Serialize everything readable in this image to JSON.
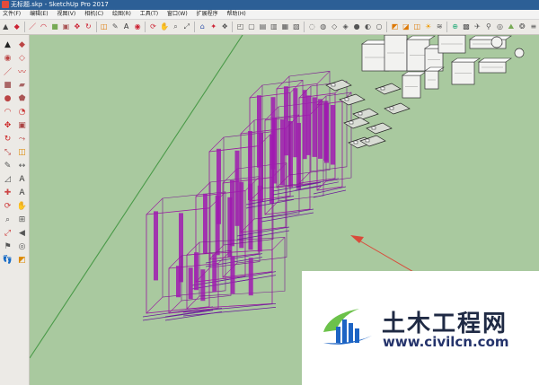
{
  "window": {
    "title": "无标题.skp - SketchUp Pro 2017"
  },
  "menu": [
    "文件(F)",
    "编辑(E)",
    "视图(V)",
    "相机(C)",
    "绘图(R)",
    "工具(T)",
    "窗口(W)",
    "扩展程序",
    "帮助(H)"
  ],
  "toolbar_icons": [
    "select-icon",
    "eraser-icon",
    "line-icon",
    "arc-icon",
    "shape-icon",
    "pushpull-icon",
    "move-icon",
    "rotate-icon",
    "offset-icon",
    "tape-icon",
    "text-icon",
    "paint-icon",
    "orbit-icon",
    "pan-icon",
    "zoom-icon",
    "zoom-extents-icon",
    "warehouse-icon",
    "extension-icon",
    "components-icon",
    "iso-view-icon",
    "top-view-icon",
    "front-view-icon",
    "right-view-icon",
    "back-view-icon",
    "left-view-icon",
    "xray-icon",
    "back-edges-icon",
    "wireframe-icon",
    "hidden-line-icon",
    "shaded-icon",
    "textured-icon",
    "monochrome-icon",
    "section-plane-icon",
    "section-display-icon",
    "section-fill-icon",
    "shadows-icon",
    "fog-icon",
    "geo-location-icon",
    "photo-textures-icon",
    "camera-position-icon",
    "walk-icon",
    "look-around-icon",
    "sandbox-icon",
    "styles-icon",
    "layers-icon"
  ],
  "sidebar_icons": [
    "select-icon",
    "make-component-icon",
    "paint-bucket-icon",
    "eraser-icon",
    "line-icon",
    "freehand-icon",
    "rectangle-icon",
    "rotated-rectangle-icon",
    "circle-icon",
    "polygon-icon",
    "arc-icon",
    "pie-icon",
    "move-icon",
    "push-pull-icon",
    "rotate-icon",
    "follow-me-icon",
    "scale-icon",
    "offset-icon",
    "tape-measure-icon",
    "dimension-icon",
    "protractor-icon",
    "text-icon",
    "axes-icon",
    "3d-text-icon",
    "orbit-icon",
    "pan-icon",
    "zoom-icon",
    "zoom-window-icon",
    "zoom-extents-icon",
    "previous-view-icon",
    "position-camera-icon",
    "look-around-icon",
    "walk-icon",
    "section-plane-icon"
  ],
  "watermark": {
    "cn": "土木工程网",
    "url": "www.civilcn.com"
  },
  "colors": {
    "ground": "#a9c99f",
    "xray_magenta": "#9a1aa0",
    "title_bar": "#2c5f96",
    "red_axis": "#d94b3b",
    "green_axis": "#4a9a49"
  }
}
